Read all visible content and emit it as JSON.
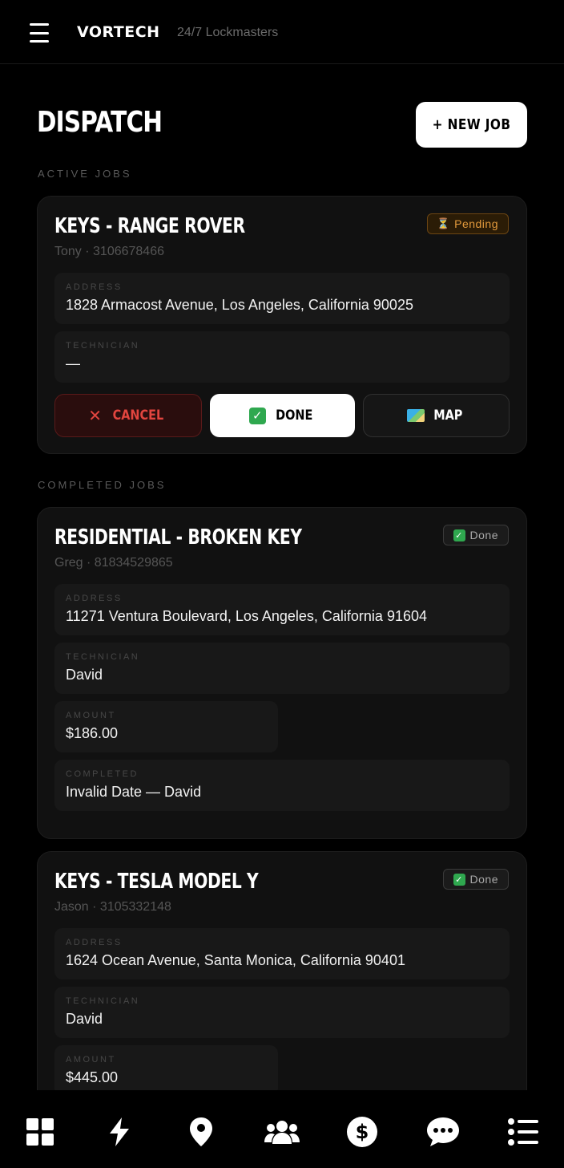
{
  "header": {
    "brand": "VORTECH",
    "subtitle": "24/7 Lockmasters"
  },
  "page": {
    "title": "DISPATCH",
    "new_job_label": "+ NEW JOB"
  },
  "sections": {
    "active_label": "ACTIVE JOBS",
    "completed_label": "COMPLETED JOBS"
  },
  "active_job": {
    "title": "KEYS - RANGE ROVER",
    "contact": "Tony · 3106678466",
    "status": "Pending",
    "status_icon": "hourglass-icon",
    "address_label": "ADDRESS",
    "address": "1828 Armacost Avenue, Los Angeles, California 90025",
    "technician_label": "TECHNICIAN",
    "technician": "—",
    "actions": {
      "cancel": "CANCEL",
      "done": "DONE",
      "map": "MAP"
    }
  },
  "completed_jobs": [
    {
      "title": "RESIDENTIAL - BROKEN KEY",
      "contact": "Greg · 81834529865",
      "status": "Done",
      "address_label": "ADDRESS",
      "address": "11271 Ventura Boulevard, Los Angeles, California 91604",
      "technician_label": "TECHNICIAN",
      "technician": "David",
      "amount_label": "AMOUNT",
      "amount": "$186.00",
      "completed_label": "COMPLETED",
      "completed": "Invalid Date — David"
    },
    {
      "title": "KEYS - TESLA MODEL Y",
      "contact": "Jason · 3105332148",
      "status": "Done",
      "address_label": "ADDRESS",
      "address": "1624 Ocean Avenue, Santa Monica, California 90401",
      "technician_label": "TECHNICIAN",
      "technician": "David",
      "amount_label": "AMOUNT",
      "amount": "$445.00"
    }
  ],
  "nav": [
    "dashboard-icon",
    "bolt-icon",
    "location-pin-icon",
    "users-icon",
    "dollar-icon",
    "chat-icon",
    "list-icon"
  ],
  "colors": {
    "background": "#000000",
    "card": "#111111",
    "pending": "#e39a3c",
    "cancel": "#e2453f",
    "done_green": "#2fa84f"
  }
}
